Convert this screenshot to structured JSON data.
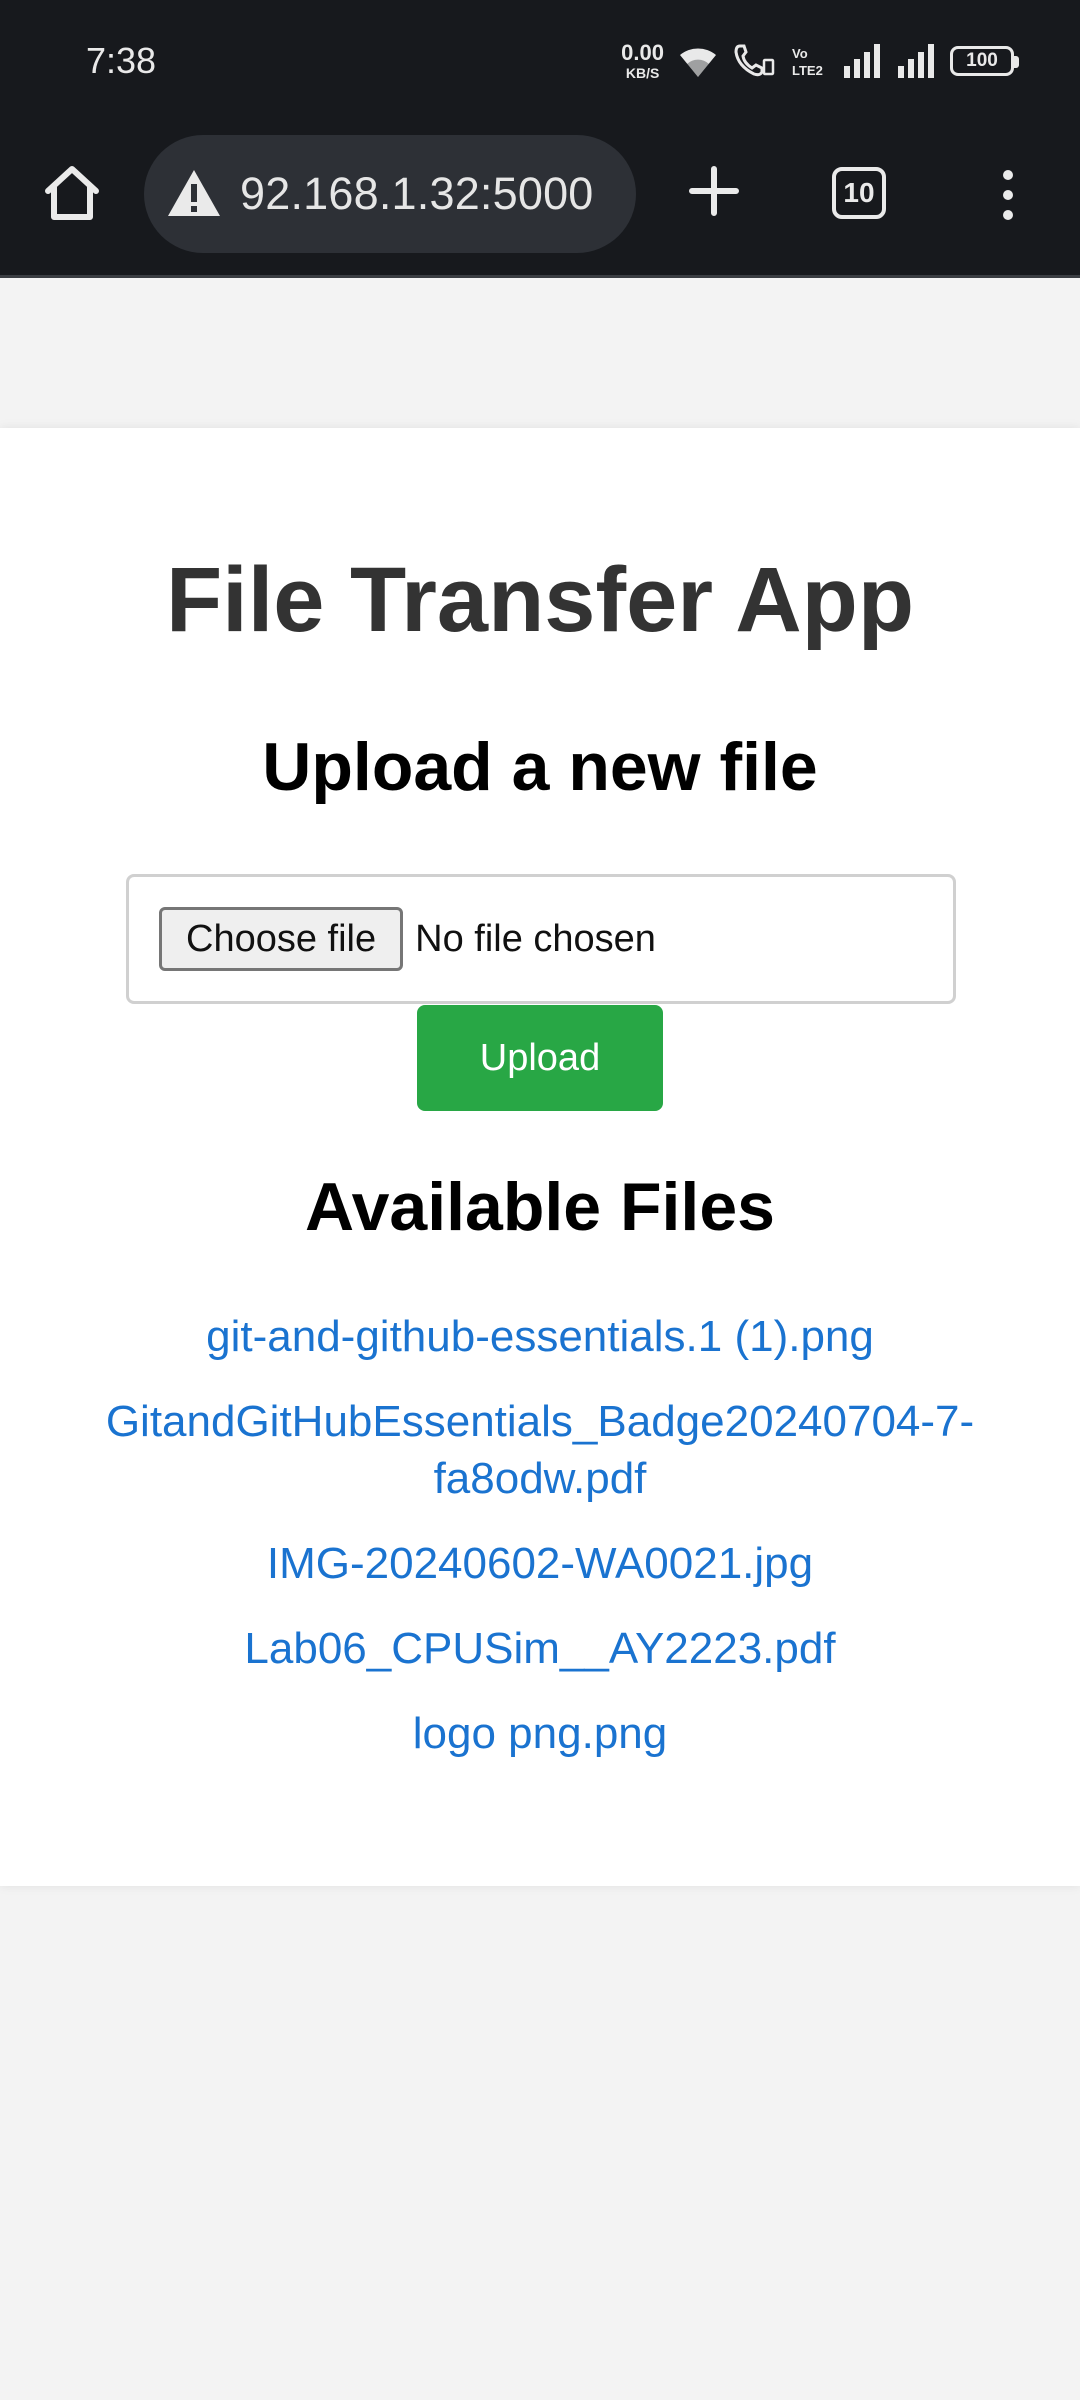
{
  "status_bar": {
    "time": "7:38",
    "net_speed": "0.00",
    "net_unit": "KB/S",
    "battery": "100"
  },
  "browser": {
    "url": "92.168.1.32:5000",
    "tab_count": "10"
  },
  "page": {
    "title": "File Transfer App",
    "upload_heading": "Upload a new file",
    "choose_file_label": "Choose file",
    "no_file_text": "No file chosen",
    "upload_button": "Upload",
    "files_heading": "Available Files",
    "files": [
      "git-and-github-essentials.1 (1).png",
      "GitandGitHubEssentials_Badge20240704-7-fa8odw.pdf",
      "IMG-20240602-WA0021.jpg",
      "Lab06_CPUSim__AY2223.pdf",
      "logo png.png"
    ]
  },
  "colors": {
    "upload_button": "#28a745",
    "link": "#1a73d0",
    "chrome_bg": "#17191d"
  }
}
